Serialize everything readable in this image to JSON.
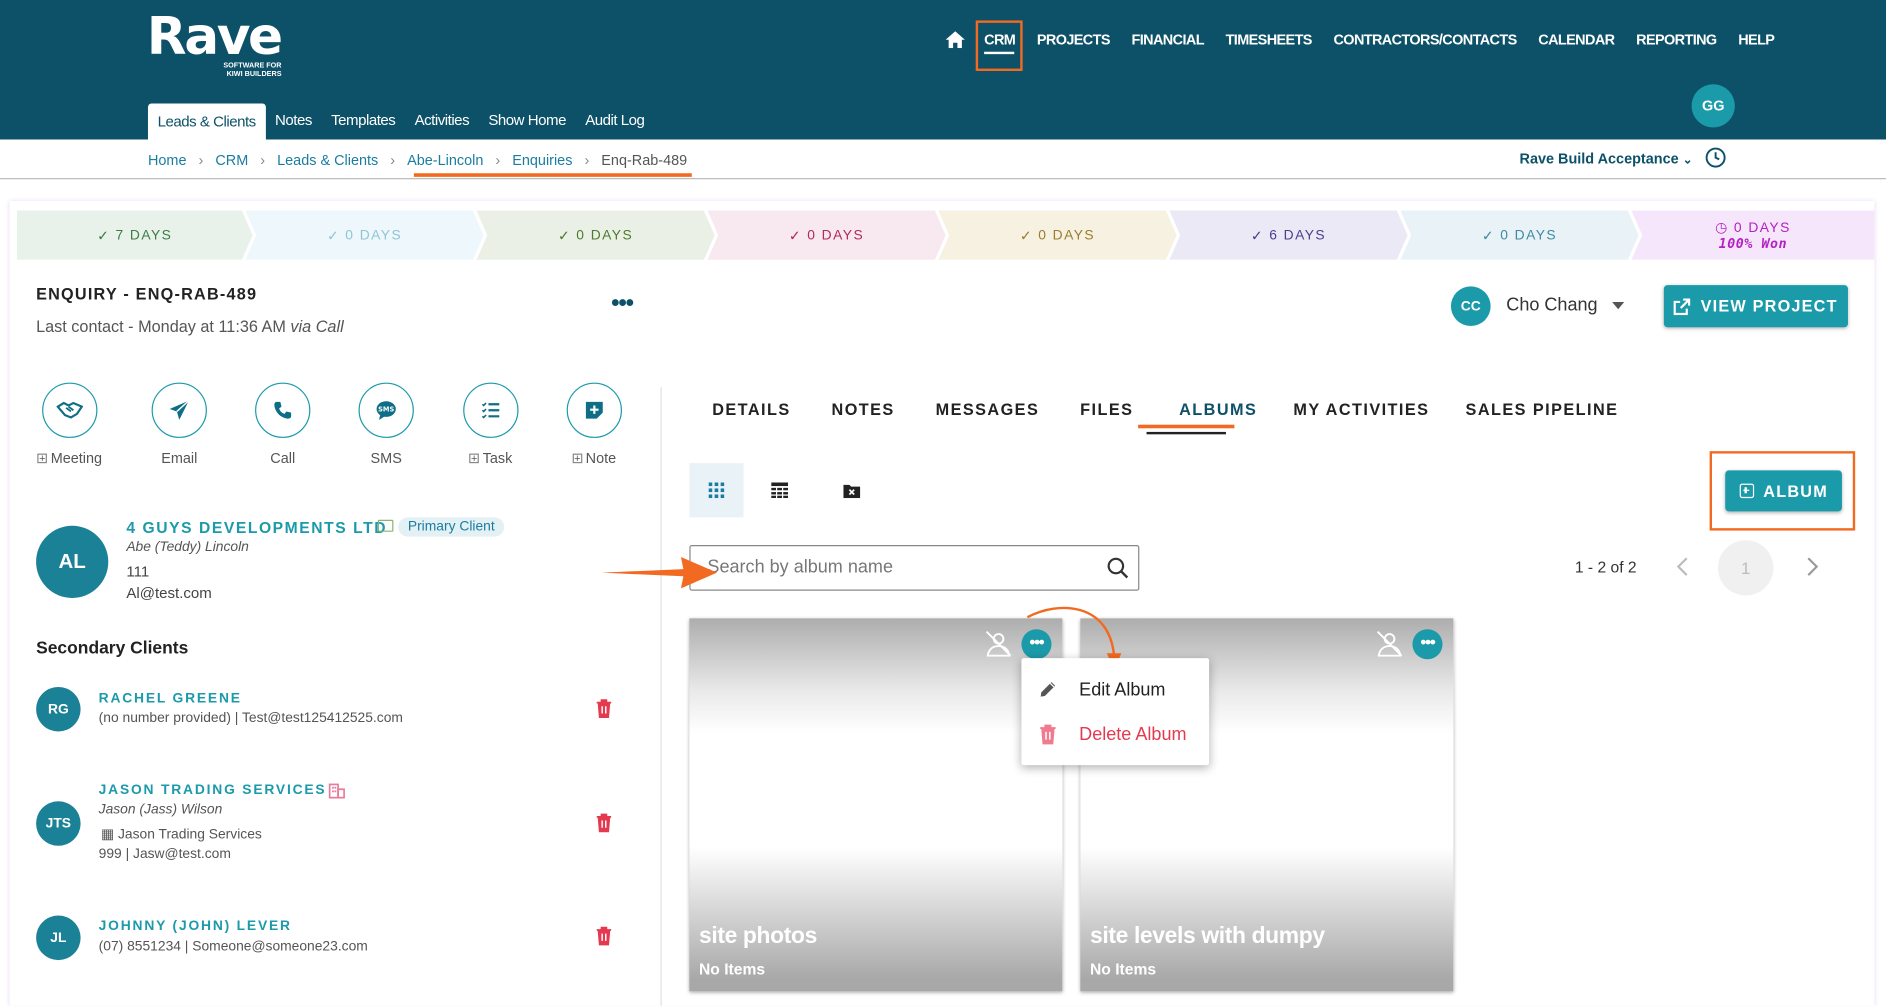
{
  "brand": {
    "name": "Rave",
    "tagline_1": "SOFTWARE FOR",
    "tagline_2": "KIWI BUILDERS"
  },
  "main_nav": [
    "CRM",
    "PROJECTS",
    "FINANCIAL",
    "TIMESHEETS",
    "CONTRACTORS/CONTACTS",
    "CALENDAR",
    "REPORTING",
    "HELP"
  ],
  "user": {
    "initials": "GG"
  },
  "sub_nav": [
    "Leads & Clients",
    "Notes",
    "Templates",
    "Activities",
    "Show Home",
    "Audit Log"
  ],
  "breadcrumb": [
    "Home",
    "CRM",
    "Leads & Clients",
    "Abe-Lincoln",
    "Enquiries",
    "Enq-Rab-489"
  ],
  "environment": "Rave Build Acceptance",
  "stages": [
    {
      "label": "7 DAYS",
      "color": "#3a7d44",
      "bg": "#e9f2ea"
    },
    {
      "label": "0 DAYS",
      "color": "#8fc6d6",
      "bg": "#eef7fb"
    },
    {
      "label": "0 DAYS",
      "color": "#4d7a2e",
      "bg": "#eaf0e6"
    },
    {
      "label": "0 DAYS",
      "color": "#b02a5a",
      "bg": "#f8e8f0"
    },
    {
      "label": "0 DAYS",
      "color": "#9a7d2e",
      "bg": "#f6f1e1"
    },
    {
      "label": "6 DAYS",
      "color": "#4a3f8f",
      "bg": "#ece9f6"
    },
    {
      "label": "0 DAYS",
      "color": "#3e8aa0",
      "bg": "#e9f3f7"
    },
    {
      "label": "0 DAYS",
      "color": "#b421c4",
      "bg": "#f6e6fb",
      "won": "100% Won"
    }
  ],
  "enquiry": {
    "title": "ENQUIRY - ENQ-RAB-489",
    "last_contact": "Last contact - Monday at 11:36 AM",
    "via": "via Call"
  },
  "assignee": {
    "initials": "CC",
    "name": "Cho Chang"
  },
  "view_project_label": "VIEW PROJECT",
  "actions": [
    "Meeting",
    "Email",
    "Call",
    "SMS",
    "Task",
    "Note"
  ],
  "primary_client": {
    "initials": "AL",
    "company": "4 GUYS DEVELOPMENTS LTD",
    "badge": "Primary Client",
    "contact": "Abe (Teddy) Lincoln",
    "phone": "111",
    "email": "Al@test.com"
  },
  "secondary_title": "Secondary Clients",
  "secondary_clients": [
    {
      "initials": "RG",
      "name": "RACHEL GREENE",
      "line1": "(no number provided)  |  Test@test125412525.com"
    },
    {
      "initials": "JTS",
      "name": "JASON TRADING SERVICES",
      "contact": "Jason (Jass) Wilson",
      "company": "Jason Trading Services",
      "line1": "999  |  Jasw@test.com"
    },
    {
      "initials": "JL",
      "name": "JOHNNY (JOHN) LEVER",
      "line1": "(07) 8551234  |  Someone@someone23.com"
    }
  ],
  "tabs": [
    "DETAILS",
    "NOTES",
    "MESSAGES",
    "FILES",
    "ALBUMS",
    "MY ACTIVITIES",
    "SALES PIPELINE"
  ],
  "album_button_label": "ALBUM",
  "search": {
    "placeholder": "Search by album name"
  },
  "pagination": {
    "range": "1 - 2 of 2",
    "page": "1"
  },
  "albums": [
    {
      "name": "site photos",
      "count": "No Items"
    },
    {
      "name": "site levels with dumpy",
      "count": "No Items"
    }
  ],
  "album_menu": {
    "edit": "Edit Album",
    "delete": "Delete Album"
  },
  "colors": {
    "header": "#0d5168",
    "accent": "#1b9aaa",
    "highlight": "#f26a21",
    "danger": "#e53950"
  }
}
